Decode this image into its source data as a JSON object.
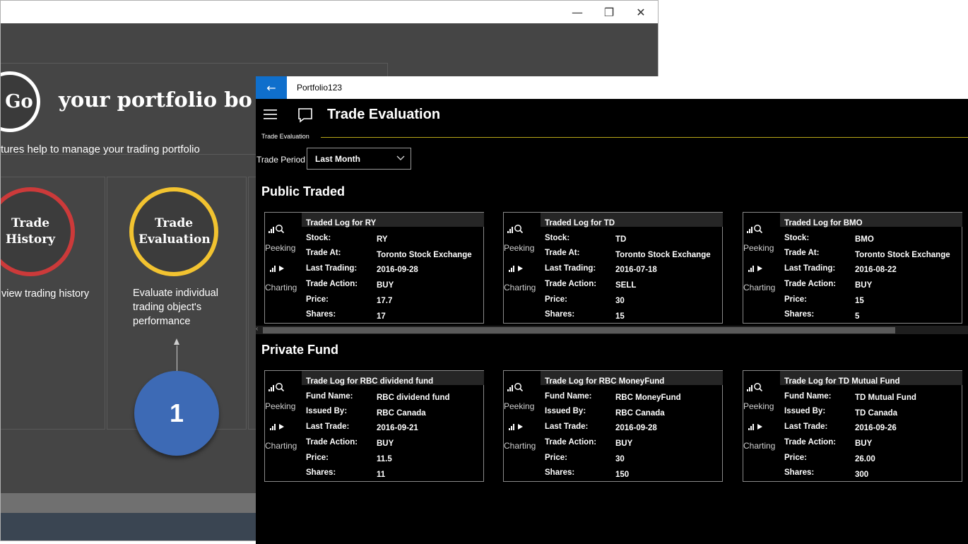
{
  "back_window": {
    "controls": {
      "minimize": "—",
      "restore": "❐",
      "close": "✕"
    },
    "badge": "Go",
    "hero_title": "your portfolio bo",
    "hero_subtitle": "tures help to manage your trading portfolio",
    "cards": [
      {
        "circle": "Trade History",
        "desc": "view trading history",
        "ring_color": "#cc3a3a"
      },
      {
        "circle": "Trade Evaluation",
        "desc": "Evaluate individual trading object's performance",
        "ring_color": "#f2c330"
      }
    ],
    "step_number": "1"
  },
  "front_window": {
    "app_title": "Portfolio123",
    "back_icon": "←",
    "page_title": "Trade Evaluation",
    "breadcrumb": "Trade Evaluation",
    "trade_period_label": "Trade Period",
    "trade_period_value": "Last Month",
    "side_labels": {
      "peeking": "Peeking",
      "charting": "Charting"
    },
    "sections": [
      {
        "heading": "Public Traded",
        "cards": [
          {
            "title": "Traded Log for RY",
            "rows": [
              {
                "label": "Stock:",
                "value": "RY"
              },
              {
                "label": "Trade At:",
                "value": "Toronto Stock Exchange"
              },
              {
                "label": "Last Trading:",
                "value": "2016-09-28"
              },
              {
                "label": "Trade Action:",
                "value": "BUY"
              },
              {
                "label": "Price:",
                "value": "17.7"
              },
              {
                "label": "Shares:",
                "value": "17"
              }
            ]
          },
          {
            "title": "Traded Log for TD",
            "rows": [
              {
                "label": "Stock:",
                "value": "TD"
              },
              {
                "label": "Trade At:",
                "value": "Toronto Stock Exchange"
              },
              {
                "label": "Last Trading:",
                "value": "2016-07-18"
              },
              {
                "label": "Trade Action:",
                "value": "SELL"
              },
              {
                "label": "Price:",
                "value": "30"
              },
              {
                "label": "Shares:",
                "value": "15"
              }
            ]
          },
          {
            "title": "Traded Log for BMO",
            "rows": [
              {
                "label": "Stock:",
                "value": "BMO"
              },
              {
                "label": "Trade At:",
                "value": "Toronto Stock Exchange"
              },
              {
                "label": "Last Trading:",
                "value": "2016-08-22"
              },
              {
                "label": "Trade Action:",
                "value": "BUY"
              },
              {
                "label": "Price:",
                "value": "15"
              },
              {
                "label": "Shares:",
                "value": "5"
              }
            ]
          }
        ]
      },
      {
        "heading": "Private Fund",
        "cards": [
          {
            "title": "Trade Log for RBC dividend fund",
            "rows": [
              {
                "label": "Fund Name:",
                "value": "RBC dividend fund"
              },
              {
                "label": "Issued By:",
                "value": "RBC Canada"
              },
              {
                "label": "Last Trade:",
                "value": "2016-09-21"
              },
              {
                "label": "Trade Action:",
                "value": "BUY"
              },
              {
                "label": "Price:",
                "value": "11.5"
              },
              {
                "label": "Shares:",
                "value": "11"
              }
            ]
          },
          {
            "title": "Trade Log for RBC MoneyFund",
            "rows": [
              {
                "label": "Fund Name:",
                "value": "RBC MoneyFund"
              },
              {
                "label": "Issued By:",
                "value": "RBC Canada"
              },
              {
                "label": "Last Trade:",
                "value": "2016-09-28"
              },
              {
                "label": "Trade Action:",
                "value": "BUY"
              },
              {
                "label": "Price:",
                "value": "30"
              },
              {
                "label": "Shares:",
                "value": "150"
              }
            ]
          },
          {
            "title": "Trade Log for TD Mutual Fund",
            "rows": [
              {
                "label": "Fund Name:",
                "value": "TD Mutual Fund"
              },
              {
                "label": "Issued By:",
                "value": "TD Canada"
              },
              {
                "label": "Last Trade:",
                "value": "2016-09-26"
              },
              {
                "label": "Trade Action:",
                "value": "BUY"
              },
              {
                "label": "Price:",
                "value": "26.00"
              },
              {
                "label": "Shares:",
                "value": "300"
              }
            ]
          }
        ]
      }
    ],
    "accent_color": "#b8a818",
    "back_button_color": "#0f6fcc"
  }
}
